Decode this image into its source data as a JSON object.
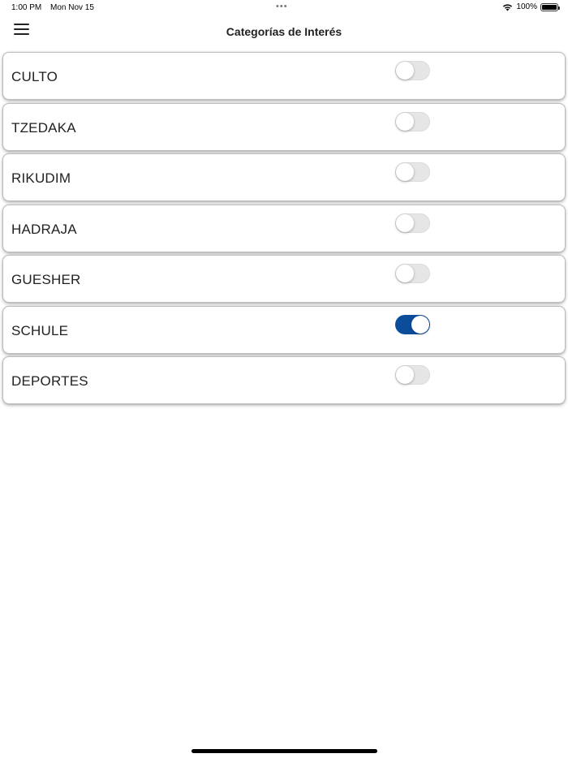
{
  "status_bar": {
    "time": "1:00 PM",
    "date": "Mon Nov 15",
    "dots": "•••",
    "battery": "100%"
  },
  "nav": {
    "title": "Categorías de Interés",
    "menu_icon": "hamburger-menu-icon"
  },
  "categories": [
    {
      "label": "CULTO",
      "enabled": false
    },
    {
      "label": "TZEDAKA",
      "enabled": false
    },
    {
      "label": "RIKUDIM",
      "enabled": false
    },
    {
      "label": "HADRAJA",
      "enabled": false
    },
    {
      "label": "GUESHER",
      "enabled": false
    },
    {
      "label": "SCHULE",
      "enabled": true
    },
    {
      "label": "DEPORTES",
      "enabled": false
    }
  ],
  "colors": {
    "toggle_on": "#0b4d9b",
    "toggle_off": "#e6e6e6"
  }
}
